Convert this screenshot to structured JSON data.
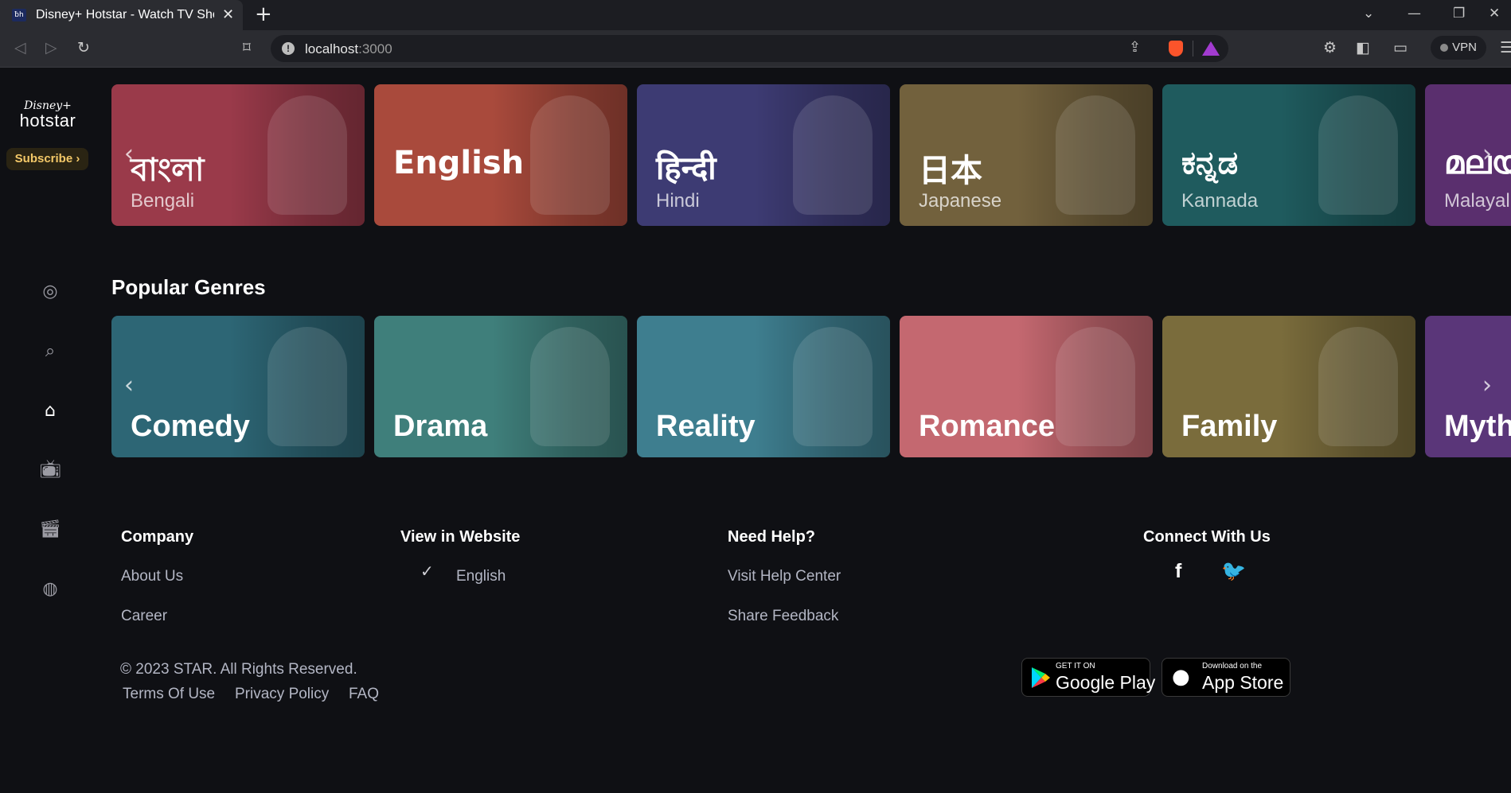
{
  "browser": {
    "tab_title": "Disney+ Hotstar - Watch TV Shows",
    "tab_favicon_text": "ƀh",
    "url_host": "localhost",
    "url_port": ":3000",
    "vpn_label": "VPN"
  },
  "sidebar": {
    "logo_disney": "Disney+",
    "logo_hotstar": "hotstar",
    "subscribe_label": "Subscribe ›",
    "nav_items": [
      {
        "name": "profile",
        "icon": "user-circle-icon"
      },
      {
        "name": "search",
        "icon": "search-icon"
      },
      {
        "name": "home",
        "icon": "home-icon",
        "active": true
      },
      {
        "name": "tv",
        "icon": "tv-icon"
      },
      {
        "name": "movies",
        "icon": "clapperboard-icon"
      },
      {
        "name": "sports",
        "icon": "ball-icon"
      }
    ]
  },
  "languages": {
    "cards": [
      {
        "native": "বাংলা",
        "name": "Bengali",
        "color": "#9a3a4a"
      },
      {
        "native": "English",
        "name": "",
        "color": "#a94a3c"
      },
      {
        "native": "हिन्दी",
        "name": "Hindi",
        "color": "#3d3b73"
      },
      {
        "native": "日本",
        "name": "Japanese",
        "color": "#72613d"
      },
      {
        "native": "ಕನ್ನಡ",
        "name": "Kannada",
        "color": "#1f5b5e"
      },
      {
        "native": "മലയ",
        "name": "Malayal",
        "color": "#5a2f6e"
      }
    ]
  },
  "genres": {
    "title": "Popular Genres",
    "cards": [
      {
        "name": "Comedy",
        "color": "#2d6675"
      },
      {
        "name": "Drama",
        "color": "#3f7f7b"
      },
      {
        "name": "Reality",
        "color": "#3e7e8f"
      },
      {
        "name": "Romance",
        "color": "#c46870"
      },
      {
        "name": "Family",
        "color": "#7a6c3c"
      },
      {
        "name": "Myth",
        "color": "#5a3679"
      }
    ]
  },
  "footer": {
    "company": {
      "title": "Company",
      "links": [
        "About Us",
        "Career"
      ]
    },
    "website": {
      "title": "View in Website",
      "selected": "English"
    },
    "help": {
      "title": "Need Help?",
      "links": [
        "Visit Help Center",
        "Share Feedback"
      ]
    },
    "connect": {
      "title": "Connect With Us",
      "facebook": "f",
      "twitter": "🐦"
    },
    "copyright": "© 2023 STAR. All Rights Reserved.",
    "legal": [
      "Terms Of Use",
      "Privacy Policy",
      "FAQ"
    ],
    "google_play": {
      "small": "GET IT ON",
      "big": "Google Play"
    },
    "app_store": {
      "small": "Download on the",
      "big": "App Store"
    }
  }
}
